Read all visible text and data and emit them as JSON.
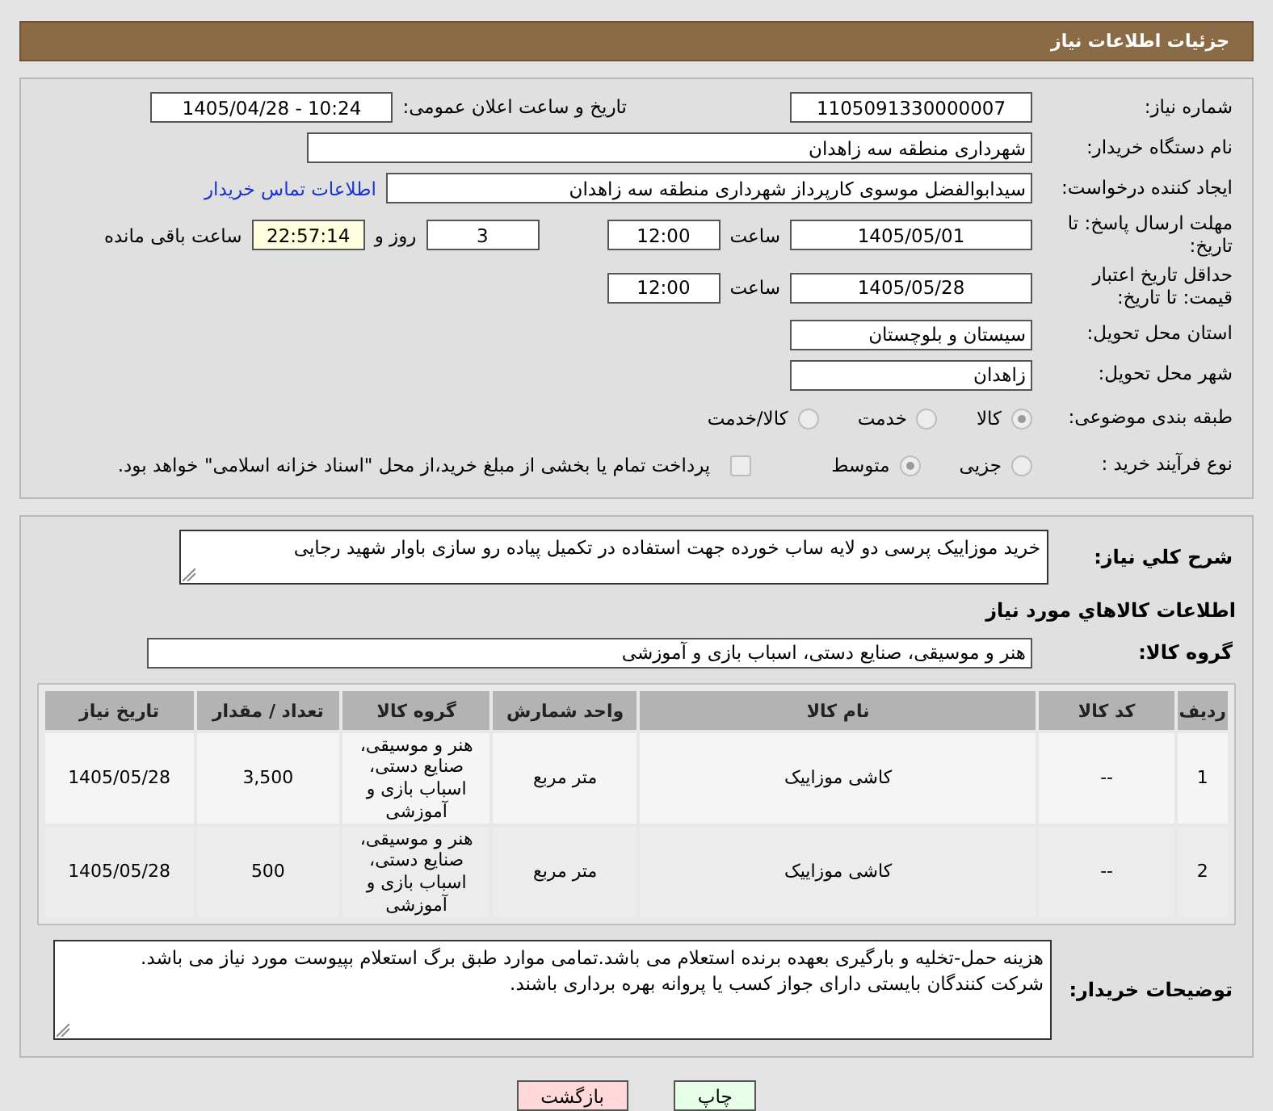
{
  "header": {
    "title": "جزئیات اطلاعات نیاز"
  },
  "need_number": {
    "label": "شماره نیاز:",
    "value": "1105091330000007"
  },
  "announce": {
    "label": "تاریخ و ساعت اعلان عمومی:",
    "value": "1405/04/28 - 10:24"
  },
  "buyer_org": {
    "label": "نام دستگاه خریدار:",
    "value": "شهرداری منطقه سه زاهدان"
  },
  "creator": {
    "label": "ایجاد کننده درخواست:",
    "value": "سیدابوالفضل موسوی کارپرداز شهرداری منطقه سه زاهدان",
    "link": "اطلاعات تماس خریدار"
  },
  "deadline": {
    "label": "مهلت ارسال پاسخ: تا تاریخ:",
    "date": "1405/05/01",
    "time_label": "ساعت",
    "time": "12:00",
    "days": "3",
    "days_label": "روز و",
    "remaining": "22:57:14",
    "remaining_label": "ساعت باقی مانده"
  },
  "validity": {
    "label": "حداقل تاریخ اعتبار قیمت: تا تاریخ:",
    "date": "1405/05/28",
    "time_label": "ساعت",
    "time": "12:00"
  },
  "province": {
    "label": "استان محل تحویل:",
    "value": "سیستان و بلوچستان"
  },
  "city": {
    "label": "شهر محل تحویل:",
    "value": "زاهدان"
  },
  "category": {
    "label": "طبقه بندی موضوعی:",
    "options": [
      {
        "label": "کالا",
        "selected": true
      },
      {
        "label": "خدمت",
        "selected": false
      },
      {
        "label": "کالا/خدمت",
        "selected": false
      }
    ]
  },
  "process": {
    "label": "نوع فرآیند خرید :",
    "options": [
      {
        "label": "جزیی",
        "selected": false
      },
      {
        "label": "متوسط",
        "selected": true
      }
    ],
    "treasury": {
      "checked": false,
      "label": "پرداخت تمام یا بخشی از مبلغ خرید،از محل \"اسناد خزانه اسلامی\" خواهد بود."
    }
  },
  "description": {
    "label": "شرح كلي نياز:",
    "value": "خرید موزاییک پرسی دو لایه ساب خورده جهت استفاده در تکمیل پیاده رو سازی باوار شهید رجایی"
  },
  "goods_heading": "اطلاعات كالاهاي مورد نياز",
  "goods_group": {
    "label": "گروه کالا:",
    "value": "هنر و موسیقی، صنایع دستی، اسباب بازی و آموزشی"
  },
  "table": {
    "columns": [
      "ردیف",
      "کد کالا",
      "نام کالا",
      "واحد شمارش",
      "گروه کالا",
      "تعداد / مقدار",
      "تاریخ نیاز"
    ],
    "rows": [
      [
        "1",
        "--",
        "کاشی موزاییک",
        "متر مربع",
        "هنر و موسیقی، صنایع دستی، اسباب بازی و آموزشی",
        "3,500",
        "1405/05/28"
      ],
      [
        "2",
        "--",
        "کاشی موزاییک",
        "متر مربع",
        "هنر و موسیقی، صنایع دستی، اسباب بازی و آموزشی",
        "500",
        "1405/05/28"
      ]
    ]
  },
  "buyer_notes": {
    "label": "توضیحات خریدار:",
    "lines": [
      "هزینه حمل-تخلیه و بارگیری بعهده برنده استعلام می باشد.تمامی موارد طبق برگ استعلام بپیوست مورد نیاز می باشد.",
      "شرکت کنندگان بایستی دارای جواز کسب یا پروانه بهره برداری باشند."
    ]
  },
  "buttons": [
    {
      "label": "چاپ",
      "kind": "print"
    },
    {
      "label": "بازگشت",
      "kind": "back"
    }
  ]
}
